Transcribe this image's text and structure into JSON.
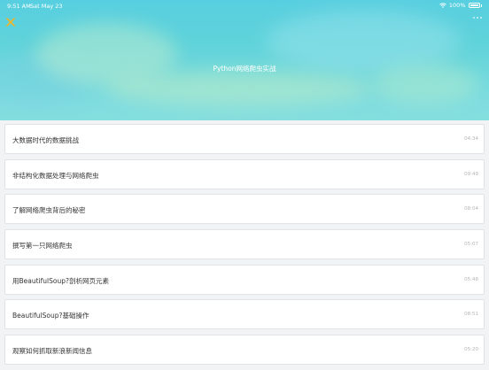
{
  "status_bar": {
    "time": "9:51 AM",
    "date": "Sat May 23",
    "battery": "100%"
  },
  "header": {
    "title": "Python网络爬虫实战",
    "background_color": "#5fd3da",
    "close_icon_color": "#f0b429"
  },
  "lessons": [
    {
      "title": "大数据时代的数据挑战",
      "duration": "04:34"
    },
    {
      "title": "非结构化数据处理与网络爬虫",
      "duration": "09:49"
    },
    {
      "title": "了解网络爬虫背后的秘密",
      "duration": "08:04"
    },
    {
      "title": "撰写第一只网络爬虫",
      "duration": "05:07"
    },
    {
      "title": "用BeautifulSoup?剖析网页元素",
      "duration": "05:48"
    },
    {
      "title": "BeautifulSoup?基础操作",
      "duration": "08:51"
    },
    {
      "title": "观察如何抓取新浪新闻信息",
      "duration": "05:20"
    }
  ]
}
